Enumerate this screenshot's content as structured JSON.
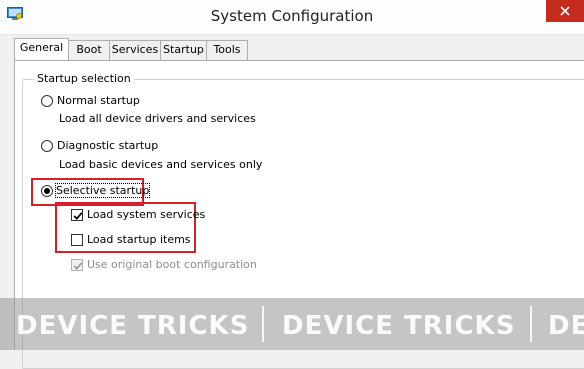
{
  "window": {
    "title": "System Configuration"
  },
  "icons": {
    "app": "system-configuration-icon",
    "close": "close-icon"
  },
  "colors": {
    "highlight": "#d3202a",
    "close_button": "#c42b1c"
  },
  "tabs": [
    {
      "label": "General",
      "active": true
    },
    {
      "label": "Boot",
      "active": false
    },
    {
      "label": "Services",
      "active": false
    },
    {
      "label": "Startup",
      "active": false
    },
    {
      "label": "Tools",
      "active": false
    }
  ],
  "startup_selection": {
    "label": "Startup selection",
    "normal": {
      "label": "Normal startup",
      "description": "Load all device drivers and services",
      "selected": false
    },
    "diagnostic": {
      "label": "Diagnostic startup",
      "description": "Load basic devices and services only",
      "selected": false
    },
    "selective": {
      "label": "Selective startup",
      "selected": true,
      "options": [
        {
          "label": "Load system services",
          "checked": true,
          "enabled": true
        },
        {
          "label": "Load startup items",
          "checked": false,
          "enabled": true
        },
        {
          "label": "Use original boot configuration",
          "checked": true,
          "enabled": false
        }
      ]
    }
  },
  "watermark": [
    "DEVICE TRICKS",
    "DEVICE TRICKS",
    "DE"
  ]
}
